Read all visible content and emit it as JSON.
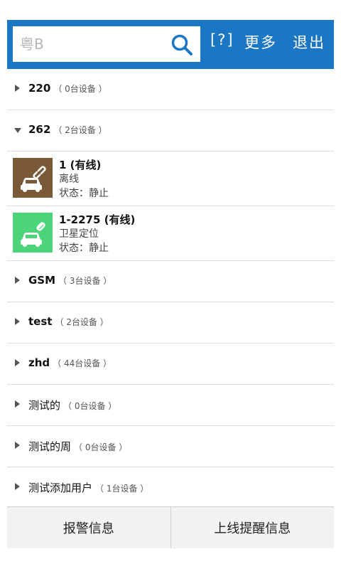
{
  "header": {
    "search_placeholder": "粤B",
    "help_label": "[?]",
    "more_label": "更多",
    "exit_label": "退出",
    "bar_color": "#1b76c3"
  },
  "groups": [
    {
      "name": "220",
      "count": "（ 0台设备 ）",
      "expanded": false
    },
    {
      "name": "262",
      "count": "（ 2台设备 ）",
      "expanded": true
    },
    {
      "name": "GSM",
      "count": "（ 3台设备 ）",
      "expanded": false
    },
    {
      "name": "test",
      "count": "（ 2台设备 ）",
      "expanded": false
    },
    {
      "name": "zhd",
      "count": "（ 44台设备 ）",
      "expanded": false
    },
    {
      "name": "测试的",
      "count": "（ 0台设备 ）",
      "expanded": false
    },
    {
      "name": "测试的周",
      "count": "（ 0台设备 ）",
      "expanded": false
    },
    {
      "name": "测试添加用户",
      "count": "（ 1台设备 ）",
      "expanded": false
    }
  ],
  "devices": [
    {
      "name": "1 (有线)",
      "status": "离线",
      "state": "状态：静止",
      "icon": "car-offline-icon",
      "color": "#7a5a36"
    },
    {
      "name": "1-2275 (有线)",
      "status": "卫星定位",
      "state": "状态：静止",
      "icon": "car-online-icon",
      "color": "#4cd47a"
    }
  ],
  "footer": {
    "alarm_label": "报警信息",
    "online_label": "上线提醒信息"
  }
}
